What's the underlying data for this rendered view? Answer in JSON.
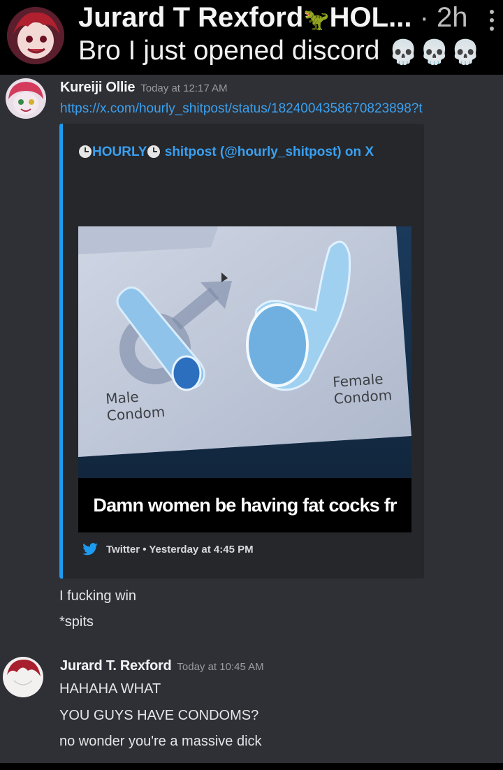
{
  "header": {
    "sender": "Jurard T Rexford",
    "sender_suffix": "HOL...",
    "time": "· 2h",
    "preview": "Bro I just opened discord",
    "emoji_icon": "skull-icon"
  },
  "messages": [
    {
      "author": "Kureiji Ollie",
      "timestamp": "Today at 12:17 AM",
      "link": "https://x.com/hourly_shitpost/status/1824004358670823898?t",
      "embed": {
        "title_part1": "HOURLY",
        "title_part2": " shitpost (@hourly_shitpost) on X",
        "image_labels": {
          "male": "Male\nCondom",
          "female": "Female\nCondom"
        },
        "image_caption": "Damn women be having fat cocks fr",
        "footer": "Twitter • Yesterday at 4:45 PM"
      },
      "lines": [
        "I fucking win",
        "*spits"
      ]
    },
    {
      "author": "Jurard T. Rexford",
      "timestamp": "Today at 10:45 AM",
      "lines": [
        "HAHAHA WHAT",
        "YOU GUYS HAVE CONDOMS?",
        "no wonder you're a massive dick"
      ]
    }
  ],
  "colors": {
    "background": "#2f3035",
    "link": "#3aa0f0",
    "embed_accent": "#1d9bf0",
    "embed_bg": "#26272b"
  }
}
